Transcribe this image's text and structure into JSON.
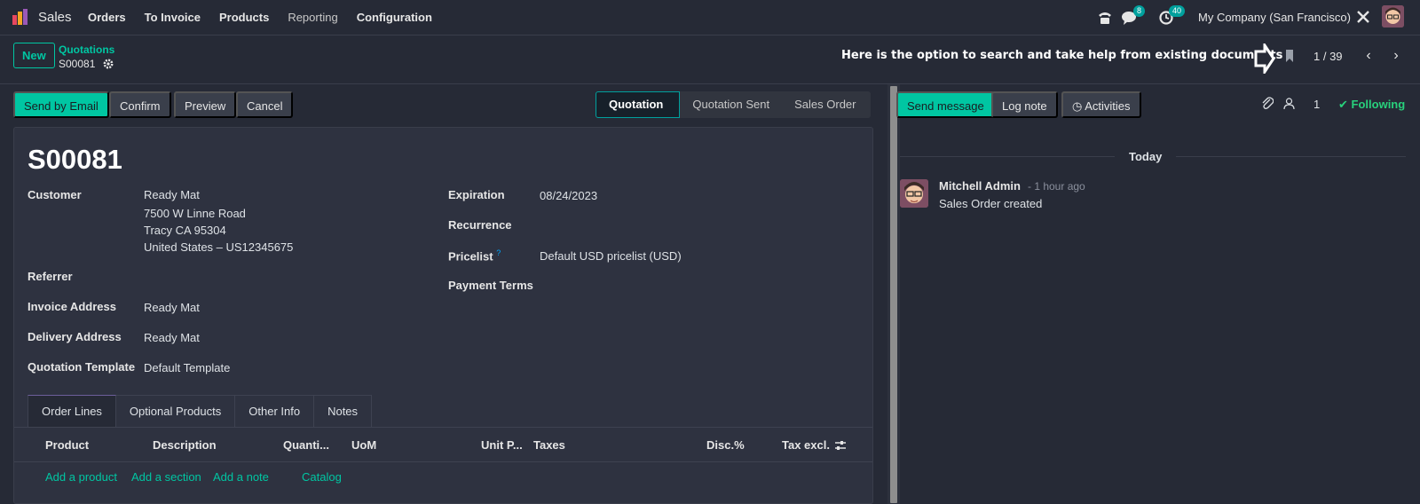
{
  "topnav": {
    "app_name": "Sales",
    "menu": [
      "Orders",
      "To Invoice",
      "Products",
      "Reporting",
      "Configuration"
    ],
    "messages_count": "8",
    "activities_count": "40",
    "company": "My Company (San Francisco)"
  },
  "control_panel": {
    "new_label": "New",
    "breadcrumb_parent": "Quotations",
    "breadcrumb_current": "S00081",
    "annotation": "Here is the option to search and take help from existing documents",
    "pager": "1 / 39"
  },
  "form": {
    "actions": [
      "Send by Email",
      "Confirm",
      "Preview",
      "Cancel"
    ],
    "stages": [
      "Quotation",
      "Quotation Sent",
      "Sales Order"
    ],
    "active_stage": "Quotation",
    "title": "S00081",
    "labels": {
      "customer": "Customer",
      "referrer": "Referrer",
      "invoice_address": "Invoice Address",
      "delivery_address": "Delivery Address",
      "quotation_template": "Quotation Template",
      "expiration": "Expiration",
      "recurrence": "Recurrence",
      "pricelist": "Pricelist",
      "pricelist_help": "?",
      "payment_terms": "Payment Terms"
    },
    "values": {
      "customer_name": "Ready Mat",
      "customer_street": "7500 W Linne Road",
      "customer_city": "Tracy CA 95304",
      "customer_country": "United States – US12345675",
      "invoice_address": "Ready Mat",
      "delivery_address": "Ready Mat",
      "quotation_template": "Default Template",
      "expiration": "08/24/2023",
      "pricelist": "Default USD pricelist (USD)"
    },
    "tabs": [
      "Order Lines",
      "Optional Products",
      "Other Info",
      "Notes"
    ],
    "columns": [
      "Product",
      "Description",
      "Quanti...",
      "UoM",
      "Unit P...",
      "Taxes",
      "Disc.%",
      "Tax excl."
    ],
    "add_links": [
      "Add a product",
      "Add a section",
      "Add a note",
      "Catalog"
    ]
  },
  "chatter": {
    "send_message": "Send message",
    "log_note": "Log note",
    "activities": "Activities",
    "follower_count": "1",
    "following": "Following",
    "day": "Today",
    "message": {
      "author": "Mitchell Admin",
      "time": "- 1 hour ago",
      "body": "Sales Order created"
    }
  },
  "colors": {
    "accent": "#00c6a2",
    "background": "#262a36",
    "sheet": "#2e3240",
    "following": "#28d17c"
  }
}
